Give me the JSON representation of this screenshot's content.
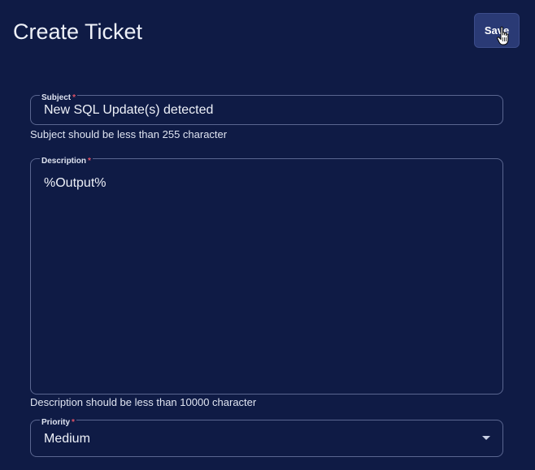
{
  "header": {
    "title": "Create Ticket",
    "save_label": "Save"
  },
  "form": {
    "subject": {
      "label": "Subject",
      "required_mark": "*",
      "value": "New SQL Update(s) detected",
      "helper": "Subject should be less than 255 character"
    },
    "description": {
      "label": "Description",
      "required_mark": "*",
      "value": "%Output%",
      "helper": "Description should be less than 10000 character"
    },
    "priority": {
      "label": "Priority",
      "required_mark": "*",
      "value": "Medium"
    }
  },
  "icons": {
    "cursor": "hand-pointer-icon",
    "dropdown": "caret-down-icon"
  },
  "colors": {
    "background": "#0f1b45",
    "button": "#2a3a75",
    "required": "#e05267",
    "border": "#5a6690"
  }
}
